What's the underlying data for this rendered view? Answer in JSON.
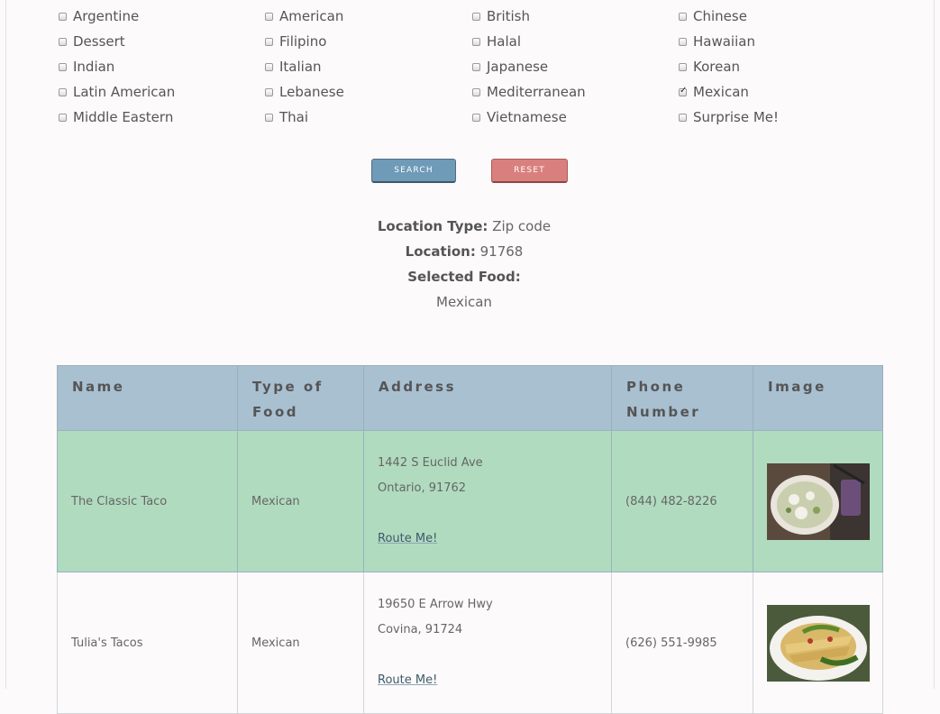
{
  "cuisines": [
    [
      {
        "label": "Argentine",
        "checked": false
      },
      {
        "label": "American",
        "checked": false
      },
      {
        "label": "British",
        "checked": false
      },
      {
        "label": "Chinese",
        "checked": false
      }
    ],
    [
      {
        "label": "Dessert",
        "checked": false
      },
      {
        "label": "Filipino",
        "checked": false
      },
      {
        "label": "Halal",
        "checked": false
      },
      {
        "label": "Hawaiian",
        "checked": false
      }
    ],
    [
      {
        "label": "Indian",
        "checked": false
      },
      {
        "label": "Italian",
        "checked": false
      },
      {
        "label": "Japanese",
        "checked": false
      },
      {
        "label": "Korean",
        "checked": false
      }
    ],
    [
      {
        "label": "Latin American",
        "checked": false
      },
      {
        "label": "Lebanese",
        "checked": false
      },
      {
        "label": "Mediterranean",
        "checked": false
      },
      {
        "label": "Mexican",
        "checked": true
      }
    ],
    [
      {
        "label": "Middle Eastern",
        "checked": false
      },
      {
        "label": "Thai",
        "checked": false
      },
      {
        "label": "Vietnamese",
        "checked": false
      },
      {
        "label": "Surprise Me!",
        "checked": false
      }
    ]
  ],
  "buttons": {
    "search": "SEARCH",
    "reset": "RESET"
  },
  "info": {
    "location_type_label": "Location Type:",
    "location_type_value": "Zip code",
    "location_label": "Location:",
    "location_value": "91768",
    "selected_food_label": "Selected Food:",
    "selected_food_value": "Mexican"
  },
  "table": {
    "headers": {
      "name": "Name",
      "type_line1": "Type of",
      "type_line2": "Food",
      "address": "Address",
      "phone_line1": "Phone",
      "phone_line2": "Number",
      "image": "Image"
    },
    "rows": [
      {
        "name": "The Classic Taco",
        "type": "Mexican",
        "address_line1": "1442 S Euclid Ave",
        "address_line2": "Ontario, 91762",
        "route": "Route Me!",
        "phone": "(844) 482-8226",
        "image_icon": "food-photo-icon"
      },
      {
        "name": "Tulia's Tacos",
        "type": "Mexican",
        "address_line1": "19650 E Arrow Hwy",
        "address_line2": "Covina, 91724",
        "route": "Route Me!",
        "phone": "(626) 551-9985",
        "image_icon": "food-photo-icon"
      }
    ]
  },
  "colors": {
    "search_button": "#6f9ab8",
    "reset_button": "#d9807e",
    "table_header": "#a9c0d1",
    "highlight_row": "#b0dbbf"
  }
}
